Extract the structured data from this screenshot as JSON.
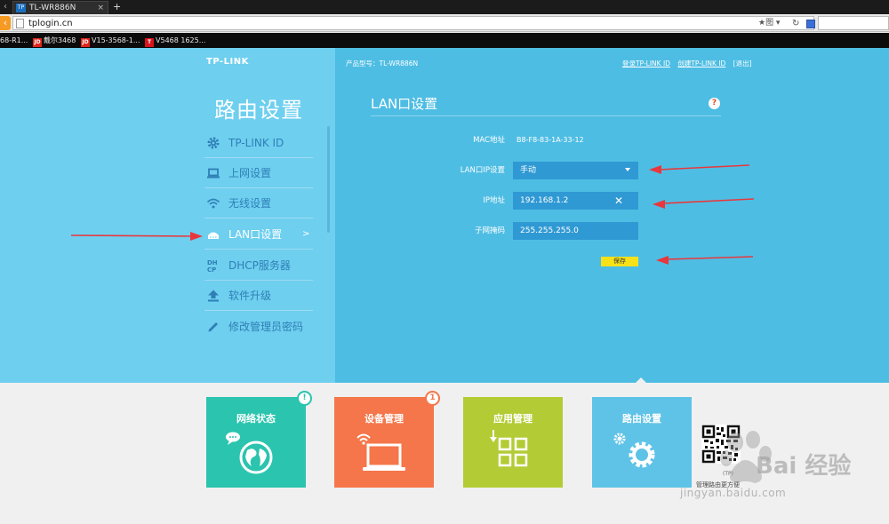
{
  "browser": {
    "tab_title": "TL-WR886N",
    "tab_favicon": "TP",
    "tab_close": "×",
    "new_tab": "+",
    "url": "tplogin.cn",
    "url_right_text": "★图 ▾",
    "bookmarks": [
      {
        "label": "68-R1..."
      },
      {
        "icon": "JD",
        "label": "戴尔3468",
        "color": "#e1251b"
      },
      {
        "icon": "JD",
        "label": "V15-3568-1...",
        "color": "#e1251b"
      },
      {
        "icon": "T",
        "label": "V5468 1625...",
        "color": "#d9131c"
      }
    ]
  },
  "header": {
    "logo": "TP-LINK",
    "model_label": "产品型号：TL-WR886N",
    "login_link": "登录TP-LINK ID",
    "create_link": "创建TP-LINK ID",
    "logout_link": "[退出]"
  },
  "sidebar": {
    "title": "路由设置",
    "items": [
      {
        "label": "TP-LINK ID",
        "icon": "gear-icon"
      },
      {
        "label": "上网设置",
        "icon": "laptop-icon"
      },
      {
        "label": "无线设置",
        "icon": "wifi-icon"
      },
      {
        "label": "LAN口设置",
        "icon": "router-icon",
        "active": true,
        "chevron": ">"
      },
      {
        "label": "DHCP服务器",
        "icon": "dhcp-icon",
        "icon_text": "DH\nCP"
      },
      {
        "label": "软件升级",
        "icon": "upload-icon"
      },
      {
        "label": "修改管理员密码",
        "icon": "pencil-icon"
      }
    ]
  },
  "lan": {
    "title": "LAN口设置",
    "help": "?",
    "mac_label": "MAC地址",
    "mac_value": "B8-F8-83-1A-33-12",
    "ip_mode_label": "LAN口IP设置",
    "ip_mode_value": "手动",
    "ip_label": "IP地址",
    "ip_value": "192.168.1.2",
    "clear_symbol": "✕",
    "mask_label": "子网掩码",
    "mask_value": "255.255.255.0",
    "save_label": "保存"
  },
  "tiles": [
    {
      "label": "网络状态",
      "color": "#2bc4ae",
      "badge": "!",
      "badge_color": "#2bc4ae",
      "icon": "globe-icon"
    },
    {
      "label": "设备管理",
      "color": "#f5764a",
      "badge": "1",
      "badge_color": "#f5764a",
      "icon": "devices-icon"
    },
    {
      "label": "应用管理",
      "color": "#b3cc35",
      "icon": "apps-icon"
    },
    {
      "label": "路由设置",
      "color": "#5fc3e7",
      "icon": "settings-icon"
    }
  ],
  "qr": {
    "caption_small": "(TP)",
    "caption": "管理路由更方便"
  },
  "watermark": {
    "text": "Bai 经验",
    "url": "jingyan.baidu.com"
  },
  "colors": {
    "left_panel": "#6ecfef",
    "right_panel": "#4ebde3",
    "input_bg": "#2f99d4",
    "save_button": "#f7e21a",
    "annotation_arrow": "#e8383d"
  }
}
